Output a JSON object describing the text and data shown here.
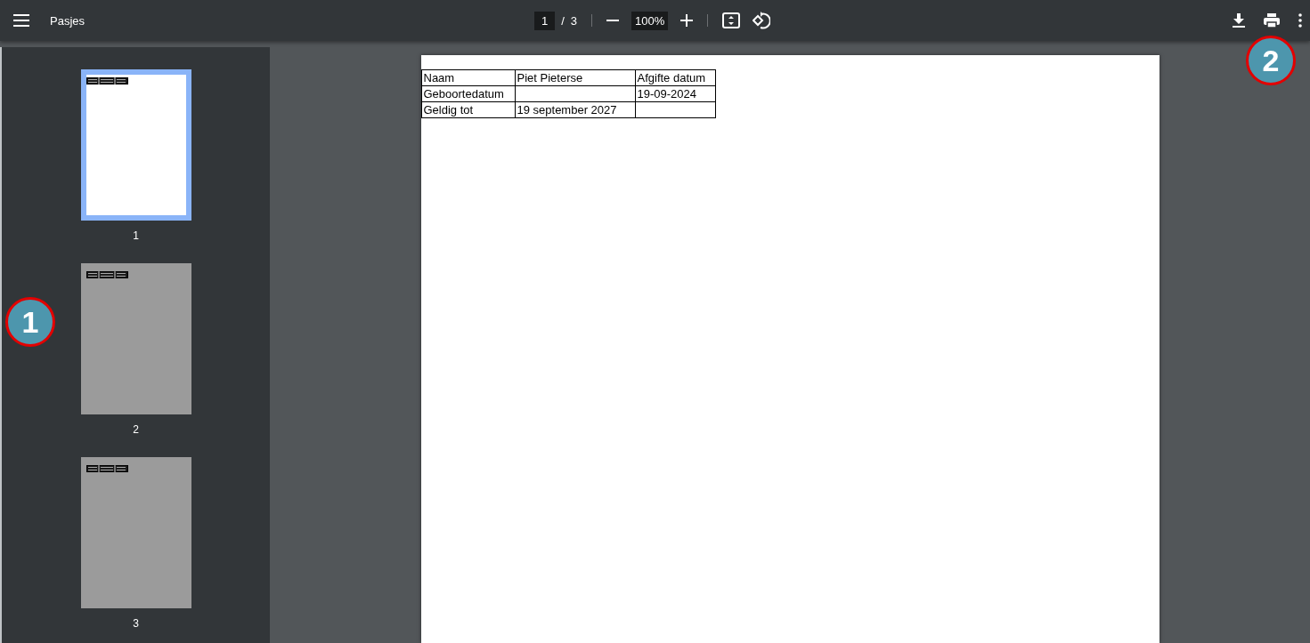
{
  "toolbar": {
    "title": "Pasjes",
    "page_input": "1",
    "page_separator": "/",
    "page_count": "3",
    "zoom": "100%"
  },
  "thumbnails": [
    {
      "label": "1",
      "selected": true
    },
    {
      "label": "2",
      "selected": false
    },
    {
      "label": "3",
      "selected": false
    }
  ],
  "document": {
    "table": {
      "rows": [
        [
          "Naam",
          "Piet Pieterse",
          "Afgifte datum"
        ],
        [
          "Geboortedatum",
          null,
          "19-09-2024"
        ],
        [
          "Geldig tot",
          "19 september 2027",
          null
        ]
      ]
    }
  },
  "callouts": [
    {
      "label": "1"
    },
    {
      "label": "2"
    }
  ]
}
